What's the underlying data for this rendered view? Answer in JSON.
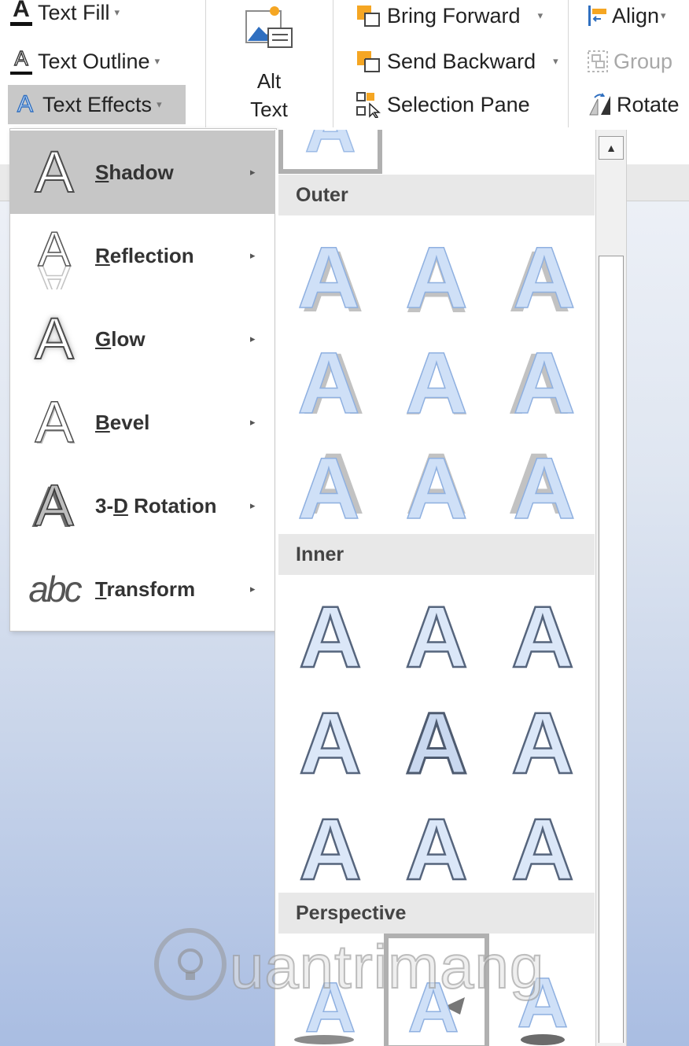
{
  "ribbon": {
    "text_fill": "Text Fill",
    "text_outline": "Text Outline",
    "text_effects": "Text Effects",
    "alt_text_line1": "Alt",
    "alt_text_line2": "Text",
    "bring_forward": "Bring Forward",
    "send_backward": "Send Backward",
    "selection_pane": "Selection Pane",
    "align": "Align",
    "group": "Group",
    "rotate": "Rotate",
    "dropdown_glyph": "▾"
  },
  "menu": {
    "submenu_arrow": "▸",
    "items": [
      {
        "mnemonic": "S",
        "rest": "hadow"
      },
      {
        "mnemonic": "R",
        "rest": "eflection"
      },
      {
        "mnemonic": "G",
        "rest": "low"
      },
      {
        "mnemonic": "B",
        "rest": "evel"
      },
      {
        "prefix": "3-",
        "mnemonic": "D",
        "rest": " Rotation"
      },
      {
        "mnemonic": "T",
        "rest": "ransform"
      }
    ],
    "transform_icon_text": "abc"
  },
  "gallery": {
    "sections": {
      "outer": "Outer",
      "inner": "Inner",
      "perspective": "Perspective"
    }
  },
  "scrollbar": {
    "up_glyph": "▲"
  },
  "watermark": {
    "text": "uantrimang"
  },
  "icons": {
    "text_fill": "text-fill-icon",
    "text_outline": "text-outline-icon",
    "text_effects": "text-effects-icon",
    "alt_text": "alt-text-picture-icon",
    "bring_forward": "bring-forward-icon",
    "send_backward": "send-backward-icon",
    "selection_pane": "selection-pane-icon",
    "align": "align-icon",
    "group": "group-icon",
    "rotate": "rotate-icon"
  },
  "colors": {
    "accent_blue": "#2f6fc0",
    "highlight_gray": "#c6c6c6",
    "section_header_bg": "#e8e8e8",
    "icon_orange": "#f5a623"
  }
}
